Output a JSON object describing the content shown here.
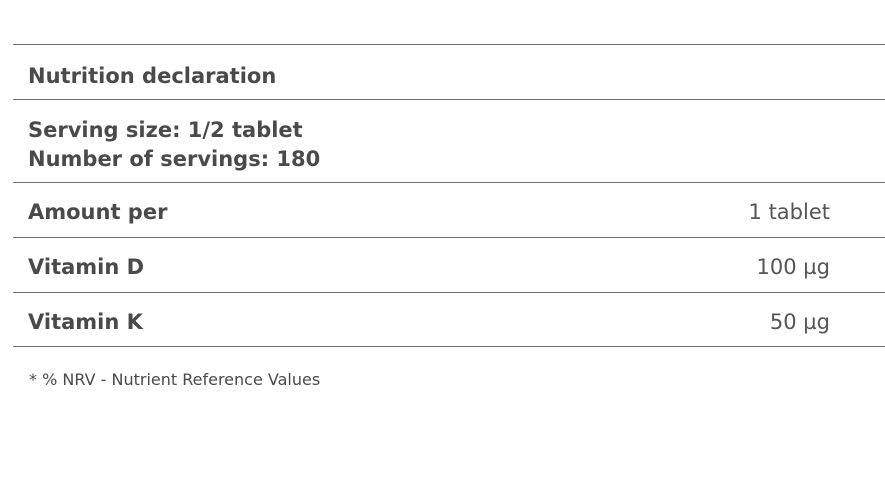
{
  "table": {
    "title": "Nutrition declaration",
    "serving_size": "Serving size: 1/2 tablet",
    "servings_count": "Number of servings: 180",
    "rows": [
      {
        "label": "Amount per",
        "value": "1 tablet"
      },
      {
        "label": "Vitamin D",
        "value": "100 µg"
      },
      {
        "label": "Vitamin K",
        "value": "50 µg"
      }
    ]
  },
  "footnote": "*  % NRV - Nutrient Reference Values"
}
